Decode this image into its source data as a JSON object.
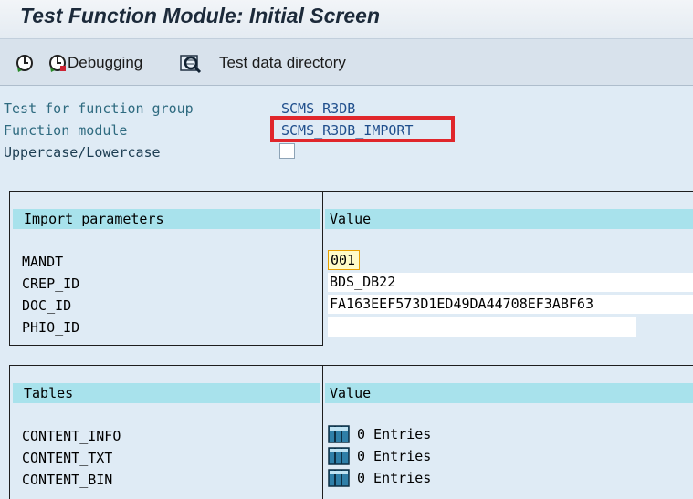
{
  "window": {
    "title": "Test Function Module: Initial Screen"
  },
  "toolbar": {
    "execute_icon": "execute-icon",
    "debugging_icon": "debug-icon",
    "debugging_label": "Debugging",
    "testdata_icon": "test-data-icon",
    "testdata_label": "Test data directory"
  },
  "header": {
    "group_label": "Test for function group",
    "group_value": "SCMS_R3DB",
    "module_label": "Function module",
    "module_value": "SCMS_R3DB_IMPORT",
    "case_label": "Uppercase/Lowercase",
    "case_checked": false
  },
  "import_params": {
    "col_name": "Import parameters",
    "col_value": "Value",
    "rows": [
      {
        "name": "MANDT",
        "value": "001"
      },
      {
        "name": "CREP_ID",
        "value": "BDS_DB22"
      },
      {
        "name": "DOC_ID",
        "value": "FA163EEF573D1ED49DA44708EF3ABF63"
      },
      {
        "name": "PHIO_ID",
        "value": ""
      }
    ]
  },
  "tables": {
    "col_name": "Tables",
    "col_value": "Value",
    "rows": [
      {
        "name": "CONTENT_INFO",
        "value": "0 Entries"
      },
      {
        "name": "CONTENT_TXT",
        "value": "0 Entries"
      },
      {
        "name": "CONTENT_BIN",
        "value": "0 Entries"
      }
    ]
  },
  "colors": {
    "highlight": "#e0262b",
    "column_header": "#a8e2ec",
    "background": "#dfebf5"
  }
}
